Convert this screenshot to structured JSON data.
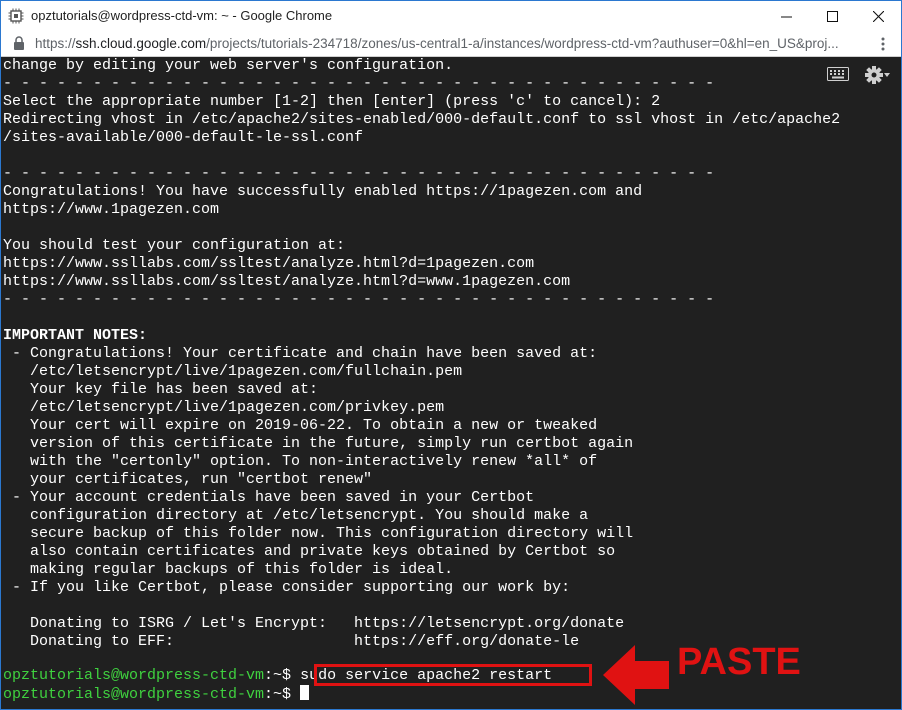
{
  "window": {
    "title": "opztutorials@wordpress-ctd-vm: ~ - Google Chrome"
  },
  "address": {
    "scheme": "https://",
    "host": "ssh.cloud.google.com",
    "path": "/projects/tutorials-234718/zones/us-central1-a/instances/wordpress-ctd-vm?authuser=0&hl=en_US&proj..."
  },
  "icons": {
    "app": "chip-icon",
    "lock": "lock-icon",
    "keyboard": "keyboard-icon",
    "settings": "gear-icon",
    "annotation_arrow": "arrow-left-icon"
  },
  "colors": {
    "terminal_bg": "#202020",
    "prompt_green": "#3fd13f",
    "annotation_red": "#e01212"
  },
  "terminal": {
    "lines": [
      "change by editing your web server's configuration.",
      "- - - - - - - - - - - - - - - - - - - - - - - - - - - - - - - - - - - - - - - -",
      "Select the appropriate number [1-2] then [enter] (press 'c' to cancel): 2",
      "Redirecting vhost in /etc/apache2/sites-enabled/000-default.conf to ssl vhost in /etc/apache2",
      "/sites-available/000-default-le-ssl.conf",
      "",
      "- - - - - - - - - - - - - - - - - - - - - - - - - - - - - - - - - - - - - - - -",
      "Congratulations! You have successfully enabled https://1pagezen.com and",
      "https://www.1pagezen.com",
      "",
      "You should test your configuration at:",
      "https://www.ssllabs.com/ssltest/analyze.html?d=1pagezen.com",
      "https://www.ssllabs.com/ssltest/analyze.html?d=www.1pagezen.com",
      "- - - - - - - - - - - - - - - - - - - - - - - - - - - - - - - - - - - - - - - -",
      "",
      "IMPORTANT NOTES:",
      " - Congratulations! Your certificate and chain have been saved at:",
      "   /etc/letsencrypt/live/1pagezen.com/fullchain.pem",
      "   Your key file has been saved at:",
      "   /etc/letsencrypt/live/1pagezen.com/privkey.pem",
      "   Your cert will expire on 2019-06-22. To obtain a new or tweaked",
      "   version of this certificate in the future, simply run certbot again",
      "   with the \"certonly\" option. To non-interactively renew *all* of",
      "   your certificates, run \"certbot renew\"",
      " - Your account credentials have been saved in your Certbot",
      "   configuration directory at /etc/letsencrypt. You should make a",
      "   secure backup of this folder now. This configuration directory will",
      "   also contain certificates and private keys obtained by Certbot so",
      "   making regular backups of this folder is ideal.",
      " - If you like Certbot, please consider supporting our work by:",
      "",
      "   Donating to ISRG / Let's Encrypt:   https://letsencrypt.org/donate",
      "   Donating to EFF:                    https://eff.org/donate-le",
      ""
    ],
    "prompt_user": "opztutorials@wordpress-ctd-vm",
    "prompt_rest": ":~$ ",
    "command": "sudo service apache2 restart"
  },
  "annotation": {
    "label": "PASTE"
  }
}
